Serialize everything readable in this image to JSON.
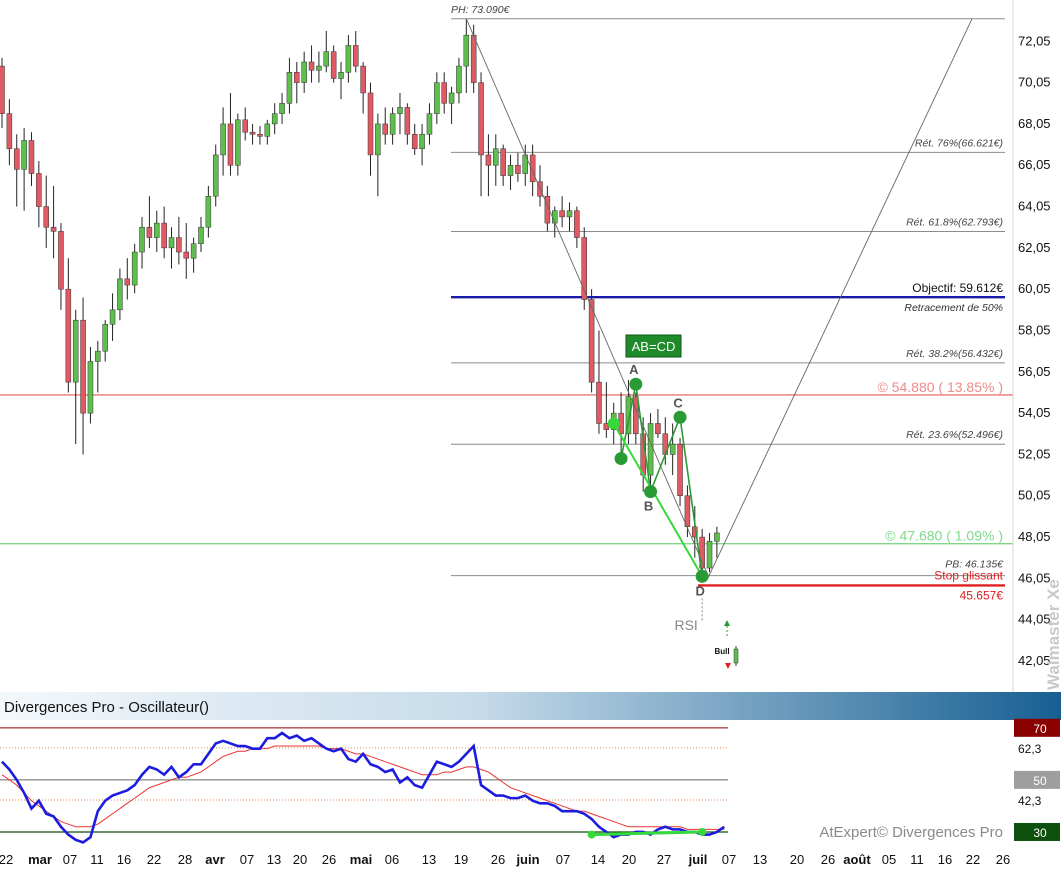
{
  "chart_data": [
    {
      "type": "candlestick",
      "ylim": [
        40.5,
        74.0
      ],
      "ytick_labels": [
        "72,05",
        "70,05",
        "68,05",
        "66,05",
        "64,05",
        "62,05",
        "60,05",
        "58,05",
        "56,05",
        "54,05",
        "52,05",
        "50,05",
        "48,05",
        "46,05",
        "44,05",
        "42,05"
      ],
      "yticks": [
        72.05,
        70.05,
        68.05,
        66.05,
        64.05,
        62.05,
        60.05,
        58.05,
        56.05,
        54.05,
        52.05,
        50.05,
        48.05,
        46.05,
        44.05,
        42.05
      ],
      "candles": [
        [
          70.8,
          71.2,
          67.8,
          68.5
        ],
        [
          68.5,
          69.2,
          66.0,
          66.8
        ],
        [
          66.8,
          67.5,
          64.0,
          65.8
        ],
        [
          65.8,
          67.8,
          63.8,
          67.2
        ],
        [
          67.2,
          67.6,
          65.0,
          65.6
        ],
        [
          65.6,
          66.2,
          63.0,
          64.0
        ],
        [
          64.0,
          65.5,
          62.0,
          63.0
        ],
        [
          63.0,
          65.0,
          61.5,
          62.8
        ],
        [
          62.8,
          63.2,
          59.0,
          60.0
        ],
        [
          60.0,
          61.5,
          55.0,
          55.5
        ],
        [
          55.5,
          59.0,
          52.5,
          58.5
        ],
        [
          58.5,
          59.6,
          52.0,
          54.0
        ],
        [
          54.0,
          57.2,
          53.5,
          56.5
        ],
        [
          56.5,
          57.5,
          55.0,
          57.0
        ],
        [
          57.0,
          58.5,
          56.5,
          58.3
        ],
        [
          58.3,
          59.8,
          57.5,
          59.0
        ],
        [
          59.0,
          61.0,
          58.5,
          60.5
        ],
        [
          60.5,
          61.5,
          59.5,
          60.2
        ],
        [
          60.2,
          62.2,
          59.8,
          61.8
        ],
        [
          61.8,
          63.5,
          61.0,
          63.0
        ],
        [
          63.0,
          64.5,
          62.0,
          62.5
        ],
        [
          62.5,
          63.8,
          61.8,
          63.2
        ],
        [
          63.2,
          64.0,
          61.5,
          62.0
        ],
        [
          62.0,
          63.0,
          61.0,
          62.5
        ],
        [
          62.5,
          63.5,
          61.2,
          61.8
        ],
        [
          61.8,
          63.2,
          60.5,
          61.5
        ],
        [
          61.5,
          62.5,
          60.8,
          62.2
        ],
        [
          62.2,
          63.5,
          61.8,
          63.0
        ],
        [
          63.0,
          65.0,
          62.5,
          64.5
        ],
        [
          64.5,
          67.0,
          64.0,
          66.5
        ],
        [
          66.5,
          68.8,
          65.5,
          68.0
        ],
        [
          68.0,
          69.5,
          65.5,
          66.0
        ],
        [
          66.0,
          68.5,
          65.5,
          68.2
        ],
        [
          68.2,
          68.8,
          67.2,
          67.6
        ],
        [
          67.6,
          68.0,
          67.0,
          67.5
        ],
        [
          67.5,
          67.9,
          67.0,
          67.4
        ],
        [
          67.4,
          68.2,
          67.0,
          68.0
        ],
        [
          68.0,
          69.0,
          67.5,
          68.5
        ],
        [
          68.5,
          69.5,
          68.0,
          69.0
        ],
        [
          69.0,
          71.2,
          68.5,
          70.5
        ],
        [
          70.5,
          71.0,
          69.0,
          70.0
        ],
        [
          70.0,
          71.5,
          69.5,
          71.0
        ],
        [
          71.0,
          71.8,
          70.0,
          70.6
        ],
        [
          70.6,
          71.5,
          70.0,
          70.8
        ],
        [
          70.8,
          72.5,
          70.5,
          71.5
        ],
        [
          71.5,
          71.8,
          70.0,
          70.2
        ],
        [
          70.2,
          71.0,
          69.2,
          70.5
        ],
        [
          70.5,
          72.3,
          70.0,
          71.8
        ],
        [
          71.8,
          72.5,
          70.5,
          70.8
        ],
        [
          70.8,
          71.0,
          68.5,
          69.5
        ],
        [
          69.5,
          70.0,
          65.5,
          66.5
        ],
        [
          66.5,
          68.5,
          64.5,
          68.0
        ],
        [
          68.0,
          68.8,
          67.0,
          67.5
        ],
        [
          67.5,
          68.8,
          67.0,
          68.5
        ],
        [
          68.5,
          69.5,
          67.5,
          68.8
        ],
        [
          68.8,
          69.0,
          67.0,
          67.5
        ],
        [
          67.5,
          68.0,
          66.5,
          66.8
        ],
        [
          66.8,
          68.0,
          66.0,
          67.5
        ],
        [
          67.5,
          69.0,
          67.0,
          68.5
        ],
        [
          68.5,
          70.5,
          68.0,
          70.0
        ],
        [
          70.0,
          70.5,
          68.5,
          69.0
        ],
        [
          69.0,
          69.8,
          68.0,
          69.5
        ],
        [
          69.5,
          71.2,
          69.0,
          70.8
        ],
        [
          70.8,
          73.09,
          69.5,
          72.3
        ],
        [
          72.3,
          72.8,
          69.5,
          70.0
        ],
        [
          70.0,
          70.5,
          64.5,
          66.5
        ],
        [
          66.5,
          67.5,
          64.5,
          66.0
        ],
        [
          66.0,
          67.5,
          65.0,
          66.8
        ],
        [
          66.8,
          67.0,
          65.0,
          65.5
        ],
        [
          65.5,
          66.5,
          64.8,
          66.0
        ],
        [
          66.0,
          66.6,
          65.2,
          65.6
        ],
        [
          65.6,
          67.0,
          65.0,
          66.5
        ],
        [
          66.5,
          67.0,
          64.5,
          65.2
        ],
        [
          65.2,
          66.0,
          64.0,
          64.5
        ],
        [
          64.5,
          65.0,
          62.8,
          63.2
        ],
        [
          63.2,
          64.0,
          62.5,
          63.8
        ],
        [
          63.8,
          64.5,
          63.0,
          63.5
        ],
        [
          63.5,
          64.2,
          62.8,
          63.8
        ],
        [
          63.8,
          64.0,
          62.0,
          62.5
        ],
        [
          62.5,
          63.0,
          59.0,
          59.5
        ],
        [
          59.5,
          60.0,
          55.0,
          55.5
        ],
        [
          55.5,
          58.0,
          53.0,
          53.5
        ],
        [
          53.5,
          55.5,
          52.8,
          53.2
        ],
        [
          53.2,
          54.5,
          52.5,
          54.0
        ],
        [
          54.0,
          55.0,
          51.8,
          53.0
        ],
        [
          53.0,
          55.6,
          52.5,
          54.8
        ],
        [
          54.8,
          55.0,
          52.5,
          53.0
        ],
        [
          53.0,
          53.8,
          50.2,
          51.0
        ],
        [
          51.0,
          54.0,
          50.5,
          53.5
        ],
        [
          53.5,
          54.2,
          52.8,
          53.0
        ],
        [
          53.0,
          53.8,
          51.5,
          52.0
        ],
        [
          52.0,
          53.5,
          51.0,
          52.5
        ],
        [
          52.5,
          52.8,
          49.5,
          50.0
        ],
        [
          50.0,
          50.5,
          48.0,
          48.5
        ],
        [
          48.5,
          49.5,
          47.0,
          48.0
        ],
        [
          48.0,
          48.4,
          46.135,
          46.5
        ],
        [
          46.5,
          48.2,
          46.3,
          47.8
        ],
        [
          47.8,
          48.5,
          47.0,
          48.2
        ]
      ],
      "fib_levels": [
        {
          "label": "Rét. 76%(66.621€)",
          "value": 66.621
        },
        {
          "label": "Rét. 61.8%(62.793€)",
          "value": 62.793
        },
        {
          "label": "Rét. 38.2%(56.432€)",
          "value": 56.432
        },
        {
          "label": "Rét. 23.6%(52.496€)",
          "value": 52.496
        }
      ],
      "ph_label": "PH: 73.090€",
      "ph_value": 73.09,
      "pb_label": "PB: 46.135€",
      "pb_value": 46.135,
      "objective_label": "Objectif: 59.612€",
      "objective_sub": "Retracement de 50%",
      "objective_value": 59.612,
      "level_red_label": "© 54.880 ( 13.85% )",
      "level_red_value": 54.88,
      "level_green_label": "© 47.680 ( 1.09% )",
      "level_green_value": 47.68,
      "stop_label": "Stop glissant",
      "stop_value_label": "45.657€",
      "stop_value": 45.657,
      "pattern_label": "AB=CD",
      "pattern_points": [
        {
          "name": "A",
          "value": 55.4
        },
        {
          "name": "B",
          "value": 50.2
        },
        {
          "name": "C",
          "value": 53.8
        },
        {
          "name": "D",
          "value": 46.1
        }
      ],
      "rsi_label": "RSI",
      "bull_label": "Bull",
      "watermark": "Walmaster Xe"
    },
    {
      "type": "line",
      "title": "Divergences Pro - Oscillateur()",
      "ylim": [
        25,
        73
      ],
      "levels": [
        {
          "label": "70",
          "value": 70
        },
        {
          "label": "62,3",
          "value": 62.3
        },
        {
          "label": "50",
          "value": 50
        },
        {
          "label": "42,3",
          "value": 42.3
        },
        {
          "label": "30",
          "value": 30
        }
      ],
      "series": [
        {
          "values": [
            57,
            54,
            50,
            45,
            39,
            42,
            37,
            36,
            32,
            29,
            27,
            26,
            28,
            38,
            42,
            44,
            45,
            46,
            48,
            52,
            55,
            54,
            52,
            55,
            51,
            53,
            56,
            56,
            60,
            64,
            65,
            64,
            63,
            63,
            62,
            62,
            66,
            66,
            68,
            66,
            67,
            65,
            66,
            64,
            62,
            61,
            62,
            58,
            57,
            60,
            56,
            55,
            53,
            54,
            49,
            51,
            48,
            47,
            52,
            57,
            56,
            55,
            57,
            60,
            63,
            48,
            46,
            44,
            44,
            43,
            43,
            44,
            42,
            41,
            41,
            40,
            38,
            38,
            38,
            37,
            35,
            32,
            30,
            28,
            29,
            29,
            30,
            30,
            29,
            31,
            32,
            31,
            31,
            30,
            30,
            29,
            29,
            30,
            32
          ]
        },
        {
          "values": [
            52,
            50,
            48,
            45,
            42,
            40,
            38,
            36,
            34,
            33,
            32,
            32,
            32,
            33,
            35,
            37,
            39,
            41,
            43,
            45,
            47,
            48,
            49,
            50,
            51,
            51,
            52,
            53,
            55,
            57,
            59,
            60,
            61,
            61,
            62,
            62,
            62,
            63,
            63,
            63,
            63,
            63,
            63,
            63,
            62,
            62,
            62,
            61,
            60,
            60,
            59,
            58,
            57,
            56,
            55,
            54,
            53,
            52,
            52,
            52,
            53,
            53,
            54,
            55,
            55,
            54,
            53,
            51,
            49,
            47,
            46,
            45,
            44,
            43,
            42,
            41,
            40,
            39,
            38,
            38,
            37,
            36,
            35,
            34,
            33,
            32,
            32,
            32,
            32,
            32,
            32,
            32,
            32,
            31,
            31,
            31,
            31,
            31,
            31
          ]
        }
      ],
      "watermark": "AtExpert© Divergences Pro"
    }
  ],
  "x_labels": [
    "22",
    "mar",
    "07",
    "11",
    "16",
    "22",
    "28",
    "avr",
    "07",
    "13",
    "20",
    "26",
    "mai",
    "06",
    "13",
    "19",
    "26",
    "juin",
    "07",
    "14",
    "20",
    "27",
    "juil",
    "07",
    "13",
    "20",
    "26",
    "août",
    "05",
    "11",
    "16",
    "22",
    "26"
  ],
  "colors": {
    "up": "#5fbf4e",
    "down": "#e05a63",
    "wick": "#222222",
    "fib": "#8c8c8c",
    "objective": "#1a1aa8",
    "red_level": "#ec8b8b",
    "green_level": "#7fd88a",
    "stop": "#e02020",
    "pattern": "#2a9a34",
    "divergence": "#36d93a",
    "osc": "#1c1ce0",
    "osc_ma": "#e83535",
    "header_dark": "#1b6496",
    "header_light": "#e8f1f8"
  }
}
